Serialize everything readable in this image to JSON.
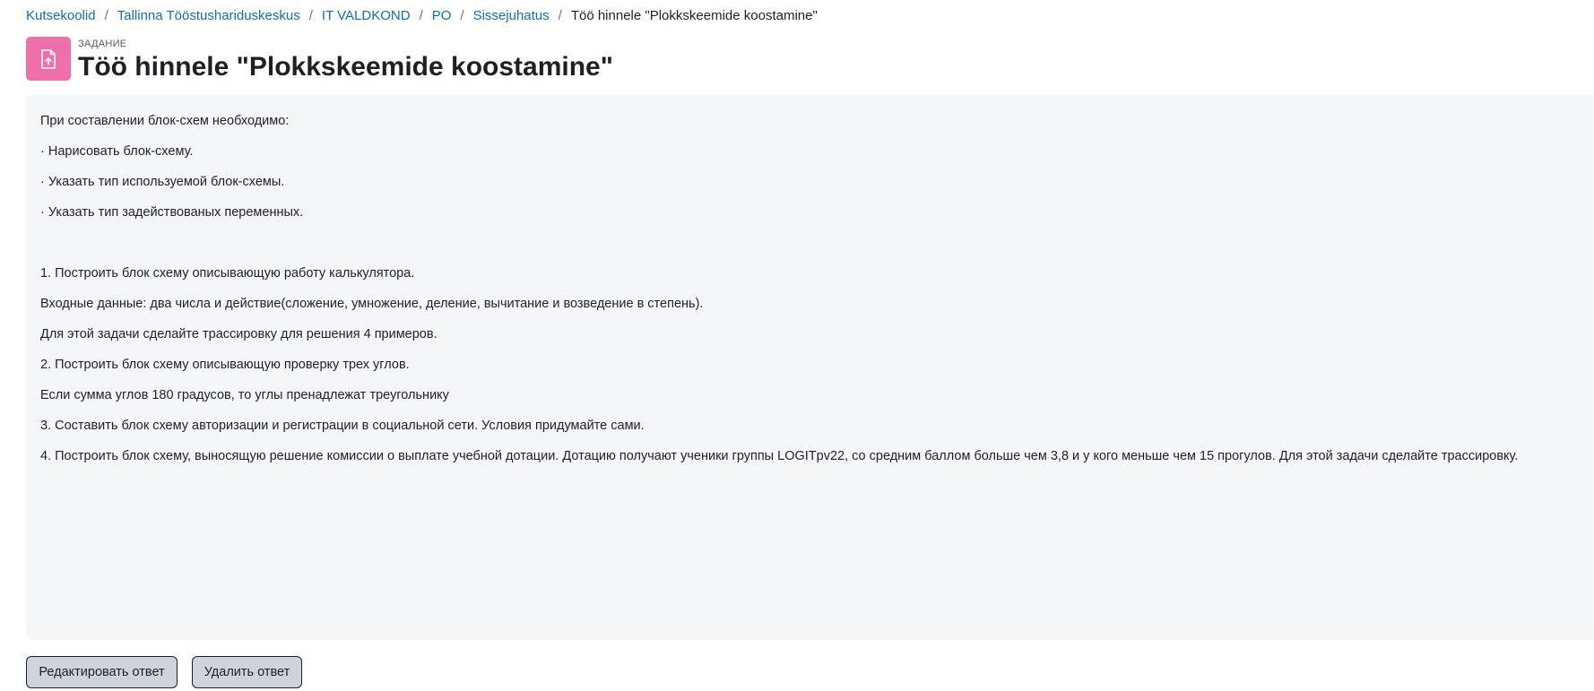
{
  "breadcrumb": {
    "items": [
      "Kutsekoolid",
      "Tallinna Tööstushariduskeskus",
      "IT VALDKOND",
      "PO",
      "Sissejuhatus"
    ],
    "separator": "/",
    "current": "Töö hinnele \"Plokkskeemide koostamine\""
  },
  "header": {
    "icon": "assignment-upload-icon",
    "icon_color": "#ef6faa",
    "activity_type": "ЗАДАНИЕ",
    "title": "Töö hinnele \"Plokkskeemide koostamine\""
  },
  "description": {
    "lines": [
      "При составлении блок-схем необходимо:",
      "· Нарисовать блок-схему.",
      "· Указать тип используемой блок-схемы.",
      "· Указать тип задействованых переменных.",
      "1. Построить блок схему описывающую работу калькулятора.",
      "Входные данные: два числа и действие(сложение, умножение, деление, вычитание и возведение в степень).",
      "Для этой задачи сделайте трассировку для решения 4 примеров.",
      "2. Построить блок схему описывающую проверку трех углов.",
      "Если сумма углов 180 градусов, то углы пренадлежат треугольнику",
      "3. Составить блок схему авторизации и регистрации в социальной сети. Условия придумайте сами.",
      "4. Построить блок схему, выносящую решение комиссии о выплате учебной дотации. Дотацию получают ученики группы LOGITpv22, со средним баллом больше чем 3,8 и у кого меньше чем 15 прогулов. Для этой задачи сделайте трассировку."
    ]
  },
  "actions": {
    "edit_label": "Редактировать ответ",
    "delete_label": "Удалить ответ"
  },
  "colors": {
    "link": "#0f6cbf",
    "description_bg": "#f5f6f8",
    "button_bg": "#ced4da"
  }
}
